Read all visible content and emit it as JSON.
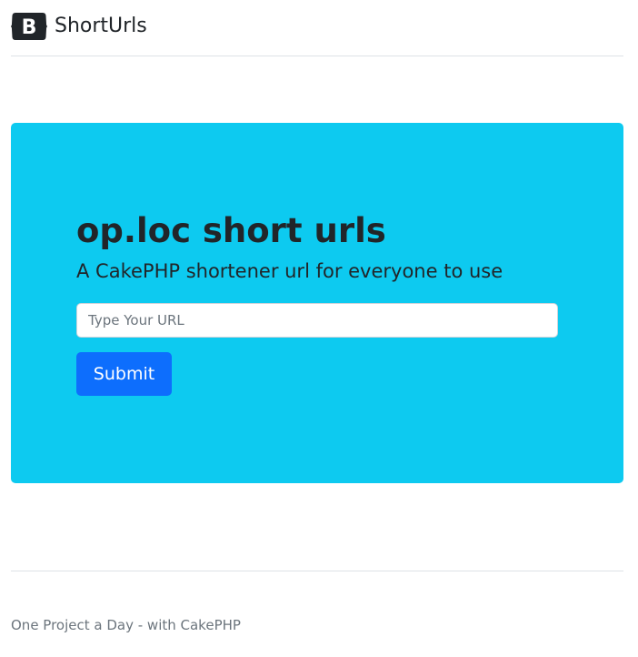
{
  "header": {
    "brand_icon": "bootstrap-logo-icon",
    "brand_name": "ShortUrls"
  },
  "hero": {
    "title": "op.loc short urls",
    "lead": "A CakePHP shortener url for everyone to use",
    "input_placeholder": "Type Your URL",
    "input_value": "",
    "submit_label": "Submit",
    "background_color": "#0dcaf0",
    "button_color": "#0d6efd"
  },
  "footer": {
    "text": "One Project a Day - with CakePHP"
  }
}
